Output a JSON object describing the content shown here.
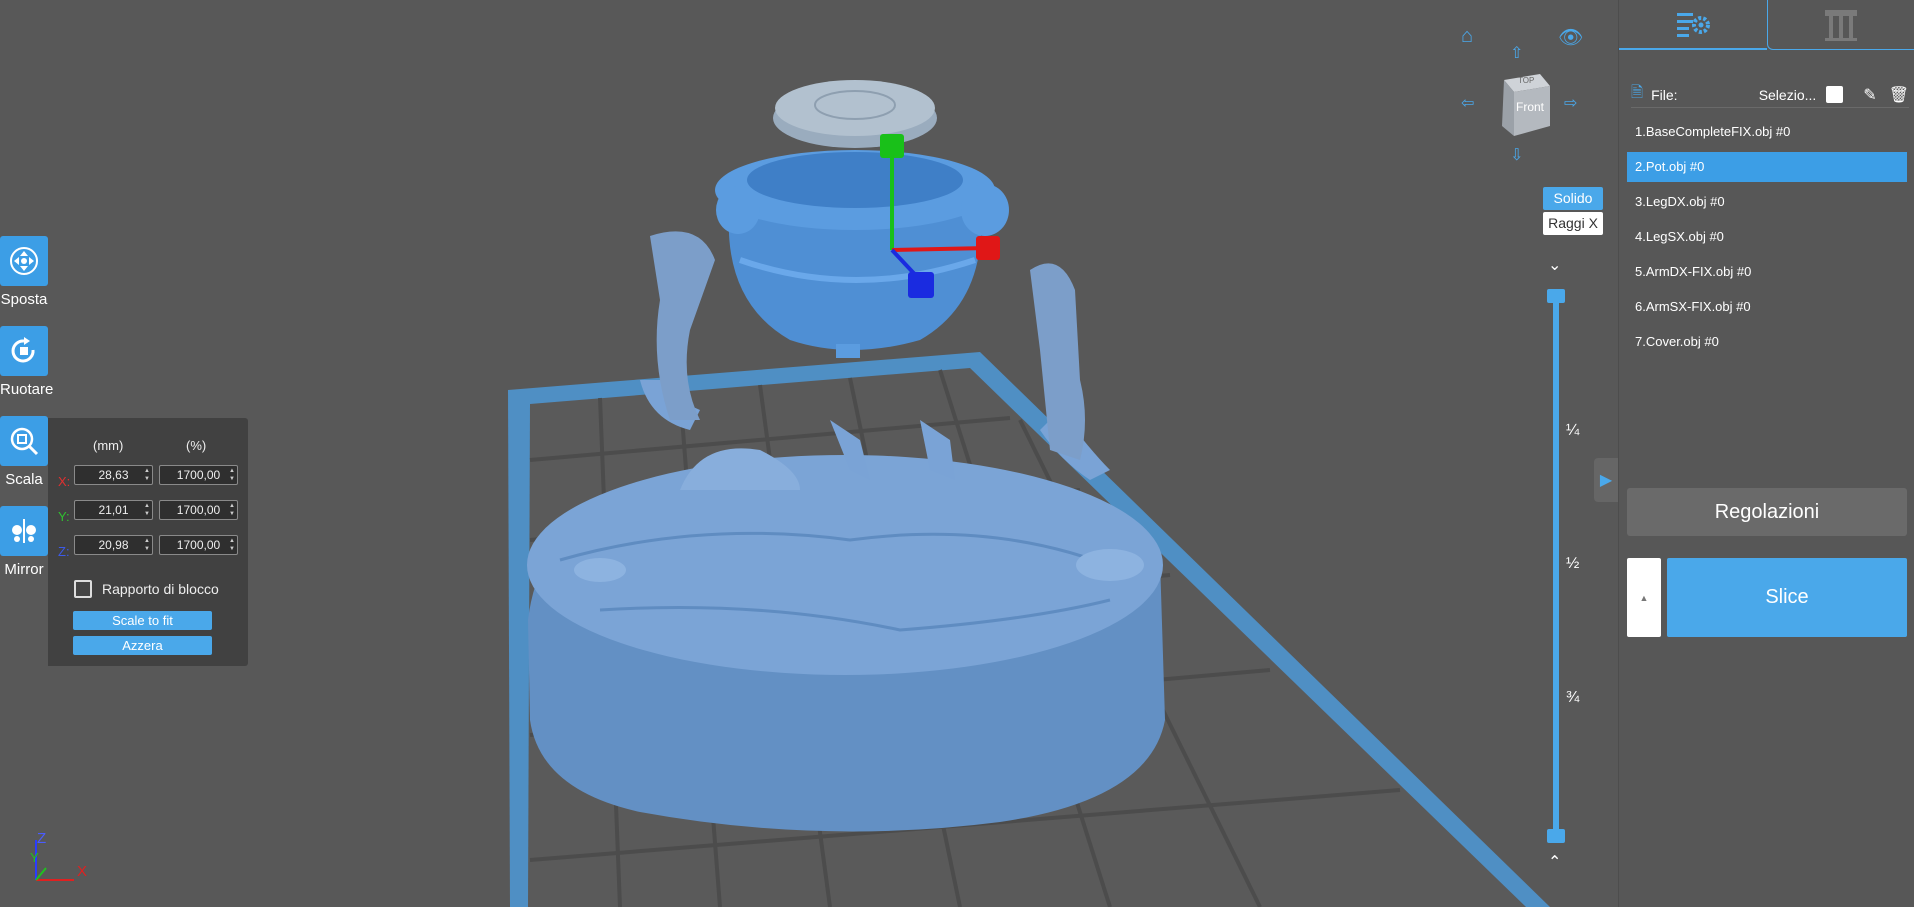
{
  "toolbar": {
    "move": "Sposta",
    "rotate": "Ruotare",
    "scale": "Scala",
    "mirror": "Mirror"
  },
  "scale_panel": {
    "col_mm": "(mm)",
    "col_pct": "(%)",
    "x_label": "X:",
    "y_label": "Y:",
    "z_label": "Z:",
    "x_mm": "28,63",
    "y_mm": "21,01",
    "z_mm": "20,98",
    "x_pct": "1700,00",
    "y_pct": "1700,00",
    "z_pct": "1700,00",
    "lock_ratio": "Rapporto di blocco",
    "scale_to_fit": "Scale to fit",
    "reset": "Azzera"
  },
  "view": {
    "cube_label": "Front",
    "cube_top": "TOP",
    "solid": "Solido",
    "xray": "Raggi X",
    "frac_quarter": "¼",
    "frac_half": "½",
    "frac_three_quarter": "¾"
  },
  "axes_gizmo": {
    "x": "X",
    "y": "Y",
    "z": "Z"
  },
  "right_panel": {
    "file_label": "File:",
    "select_label": "Selezio...",
    "files": [
      "1.BaseCompleteFIX.obj #0",
      "2.Pot.obj #0",
      "3.LegDX.obj #0",
      "4.LegSX.obj #0",
      "5.ArmDX-FIX.obj #0",
      "6.ArmSX-FIX.obj #0",
      "7.Cover.obj #0"
    ],
    "selected_index": 1,
    "adjust": "Regolazioni",
    "slice": "Slice"
  },
  "colors": {
    "accent": "#4aa8ea",
    "model": "#6f9bd0",
    "background": "#585858",
    "panel": "#414141"
  }
}
